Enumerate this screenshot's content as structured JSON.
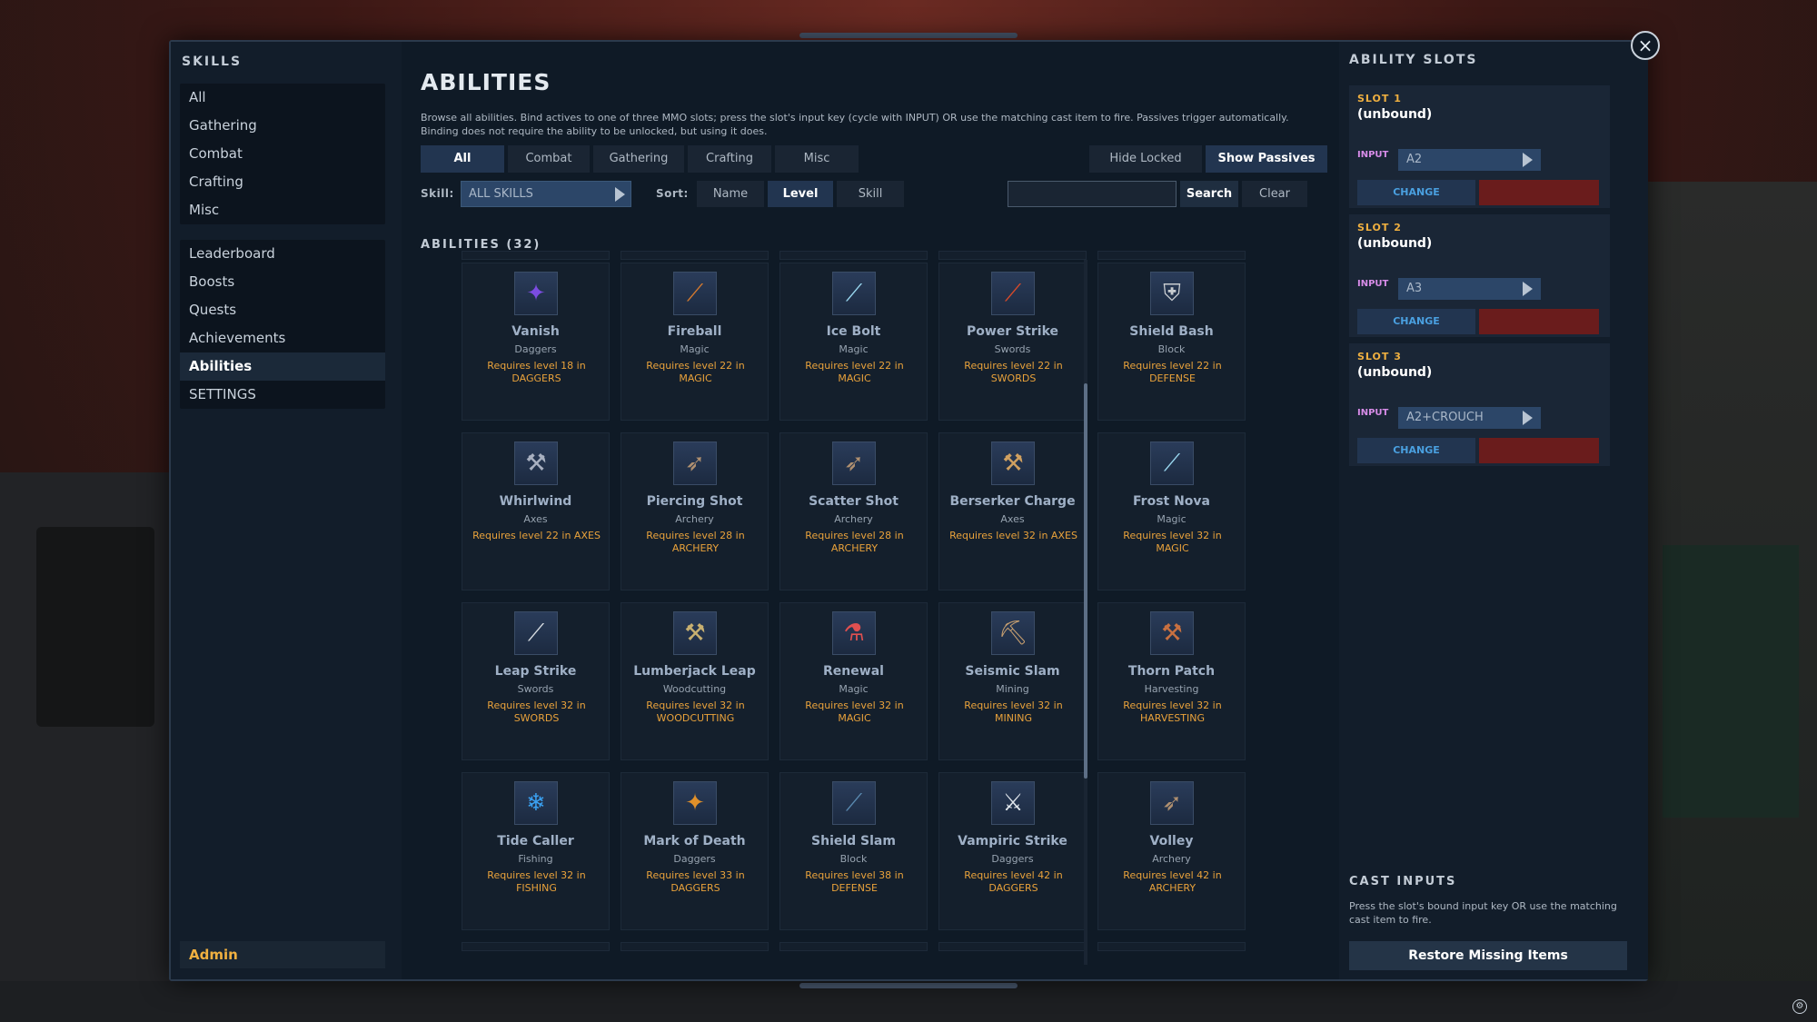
{
  "colors": {
    "accent": "#f0b040",
    "requirement": "#e9a23b",
    "active_tab": "#223550",
    "input_label": "#d78ce8",
    "change_text": "#4aa0e0",
    "danger": "#6a1c1c"
  },
  "close_icon": "×",
  "sidebar": {
    "title": "SKILLS",
    "skill_items": [
      {
        "label": "All"
      },
      {
        "label": "Gathering"
      },
      {
        "label": "Combat"
      },
      {
        "label": "Crafting"
      },
      {
        "label": "Misc"
      }
    ],
    "menu_items": [
      {
        "label": "Leaderboard"
      },
      {
        "label": "Boosts"
      },
      {
        "label": "Quests"
      },
      {
        "label": "Achievements"
      },
      {
        "label": "Abilities"
      },
      {
        "label": "SETTINGS"
      }
    ],
    "admin_label": "Admin"
  },
  "main": {
    "title": "ABILITIES",
    "description": "Browse all abilities. Bind actives to one of three MMO slots; press the slot's input key (cycle with INPUT) OR use the matching cast item to fire. Passives trigger automatically. Binding does not require the ability to be unlocked, but using it does.",
    "tabs": [
      {
        "label": "All"
      },
      {
        "label": "Combat"
      },
      {
        "label": "Gathering"
      },
      {
        "label": "Crafting"
      },
      {
        "label": "Misc"
      }
    ],
    "hide_locked_label": "Hide Locked",
    "show_passives_label": "Show Passives",
    "skill_label": "Skill:",
    "skill_value": "ALL SKILLS",
    "sort_label": "Sort:",
    "sort_options": [
      {
        "label": "Name"
      },
      {
        "label": "Level"
      },
      {
        "label": "Skill"
      }
    ],
    "search_value": "",
    "search_label": "Search",
    "clear_label": "Clear",
    "section_title": "ABILITIES (32)",
    "abilities": [
      {
        "name": "Vanish",
        "skill": "Daggers",
        "req": "Requires level 18 in DAGGERS",
        "icon": "purple-gem-icon",
        "glyph": "✦",
        "color": "#7b4ce0"
      },
      {
        "name": "Fireball",
        "skill": "Magic",
        "req": "Requires level 22 in MAGIC",
        "icon": "fire-staff-icon",
        "glyph": "⟋",
        "color": "#d67a2e"
      },
      {
        "name": "Ice Bolt",
        "skill": "Magic",
        "req": "Requires level 22 in MAGIC",
        "icon": "ice-staff-icon",
        "glyph": "⟋",
        "color": "#9ad8f0"
      },
      {
        "name": "Power Strike",
        "skill": "Swords",
        "req": "Requires level 22 in SWORDS",
        "icon": "flame-sword-icon",
        "glyph": "⟋",
        "color": "#d84a2a"
      },
      {
        "name": "Shield Bash",
        "skill": "Block",
        "req": "Requires level 22 in DEFENSE",
        "icon": "shield-icon",
        "glyph": "⛨",
        "color": "#c8ccd0"
      },
      {
        "name": "Whirlwind",
        "skill": "Axes",
        "req": "Requires level 22 in AXES",
        "icon": "axe-icon",
        "glyph": "⚒",
        "color": "#a8b0c0"
      },
      {
        "name": "Piercing Shot",
        "skill": "Archery",
        "req": "Requires level 28 in ARCHERY",
        "icon": "arrow-icon",
        "glyph": "➶",
        "color": "#b09070"
      },
      {
        "name": "Scatter Shot",
        "skill": "Archery",
        "req": "Requires level 28 in ARCHERY",
        "icon": "arrow-icon",
        "glyph": "➶",
        "color": "#b09070"
      },
      {
        "name": "Berserker Charge",
        "skill": "Axes",
        "req": "Requires level 32 in AXES",
        "icon": "battle-axe-icon",
        "glyph": "⚒",
        "color": "#d0a060"
      },
      {
        "name": "Frost Nova",
        "skill": "Magic",
        "req": "Requires level 32 in MAGIC",
        "icon": "frost-staff-icon",
        "glyph": "⟋",
        "color": "#9ad8f0"
      },
      {
        "name": "Leap Strike",
        "skill": "Swords",
        "req": "Requires level 32 in SWORDS",
        "icon": "sword-icon",
        "glyph": "⟋",
        "color": "#d8dde2"
      },
      {
        "name": "Lumberjack Leap",
        "skill": "Woodcutting",
        "req": "Requires level 32 in WOODCUTTING",
        "icon": "wood-axe-icon",
        "glyph": "⚒",
        "color": "#c8b070"
      },
      {
        "name": "Renewal",
        "skill": "Magic",
        "req": "Requires level 32 in MAGIC",
        "icon": "potion-icon",
        "glyph": "⚗",
        "color": "#e05050"
      },
      {
        "name": "Seismic Slam",
        "skill": "Mining",
        "req": "Requires level 32 in MINING",
        "icon": "pickaxe-icon",
        "glyph": "⛏",
        "color": "#c8a070"
      },
      {
        "name": "Thorn Patch",
        "skill": "Harvesting",
        "req": "Requires level 32 in HARVESTING",
        "icon": "hoe-icon",
        "glyph": "⚒",
        "color": "#c87040"
      },
      {
        "name": "Tide Caller",
        "skill": "Fishing",
        "req": "Requires level 32 in FISHING",
        "icon": "water-gem-icon",
        "glyph": "❄",
        "color": "#3aa0f0"
      },
      {
        "name": "Mark of Death",
        "skill": "Daggers",
        "req": "Requires level 33 in DAGGERS",
        "icon": "dagger-icon",
        "glyph": "✦",
        "color": "#e0902a"
      },
      {
        "name": "Shield Slam",
        "skill": "Block",
        "req": "Requires level 38 in DEFENSE",
        "icon": "mace-icon",
        "glyph": "⟋",
        "color": "#5a8ab0"
      },
      {
        "name": "Vampiric Strike",
        "skill": "Daggers",
        "req": "Requires level 42 in DAGGERS",
        "icon": "double-axe-icon",
        "glyph": "⚔",
        "color": "#e0e6ec"
      },
      {
        "name": "Volley",
        "skill": "Archery",
        "req": "Requires level 42 in ARCHERY",
        "icon": "arrow-icon",
        "glyph": "➶",
        "color": "#b09070"
      }
    ]
  },
  "slots_panel": {
    "title": "ABILITY SLOTS",
    "slots": [
      {
        "label": "SLOT 1",
        "value": "(unbound)",
        "input_label": "INPUT",
        "input_value": "A2",
        "change_label": "CHANGE"
      },
      {
        "label": "SLOT 2",
        "value": "(unbound)",
        "input_label": "INPUT",
        "input_value": "A3",
        "change_label": "CHANGE"
      },
      {
        "label": "SLOT 3",
        "value": "(unbound)",
        "input_label": "INPUT",
        "input_value": "A2+CROUCH",
        "change_label": "CHANGE"
      }
    ],
    "cast_title": "CAST INPUTS",
    "cast_description": "Press the slot's bound input key OR use the matching cast item to fire.",
    "restore_label": "Restore Missing Items"
  },
  "corner_icon": "⚙"
}
